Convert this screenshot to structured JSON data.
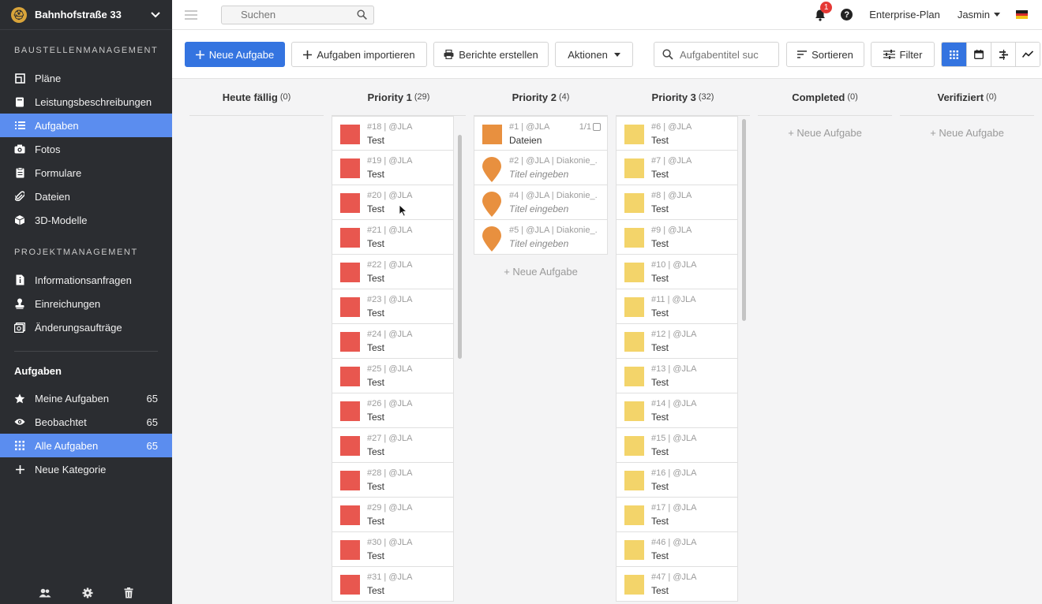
{
  "project": {
    "name": "Bahnhofstraße 33",
    "logo": "helmet-icon"
  },
  "top": {
    "search_placeholder": "Suchen",
    "notifications": "1",
    "help": "?",
    "plan": "Enterprise-Plan",
    "user": "Jasmin"
  },
  "sidebar": {
    "section1": "BAUSTELLENMANAGEMENT",
    "items1": [
      {
        "label": "Pläne",
        "icon": "plans-icon"
      },
      {
        "label": "Leistungsbeschreibungen",
        "icon": "book-icon"
      },
      {
        "label": "Aufgaben",
        "icon": "list-icon"
      },
      {
        "label": "Fotos",
        "icon": "camera-icon"
      },
      {
        "label": "Formulare",
        "icon": "clipboard-icon"
      },
      {
        "label": "Dateien",
        "icon": "paperclip-icon"
      },
      {
        "label": "3D-Modelle",
        "icon": "cube-icon"
      }
    ],
    "section2": "PROJEKTMANAGEMENT",
    "items2": [
      {
        "label": "Informationsanfragen",
        "icon": "info-doc-icon"
      },
      {
        "label": "Einreichungen",
        "icon": "stamp-icon"
      },
      {
        "label": "Änderungsaufträge",
        "icon": "change-order-icon"
      }
    ],
    "tasks_heading": "Aufgaben",
    "task_items": [
      {
        "label": "Meine Aufgaben",
        "count": "65",
        "icon": "star-icon"
      },
      {
        "label": "Beobachtet",
        "count": "65",
        "icon": "eye-icon"
      },
      {
        "label": "Alle Aufgaben",
        "count": "65",
        "icon": "grid-icon"
      },
      {
        "label": "Neue Kategorie",
        "count": "",
        "icon": "plus-icon"
      }
    ]
  },
  "toolbar": {
    "new_task": "Neue Aufgabe",
    "import": "Aufgaben importieren",
    "reports": "Berichte erstellen",
    "actions": "Aktionen",
    "search_placeholder": "Aufgabentitel suc",
    "sort": "Sortieren",
    "filter": "Filter"
  },
  "colors": {
    "accent": "#3474e0",
    "priority1": "#e8574f",
    "priority2": "#e8903f",
    "priority3": "#f3d46a"
  },
  "board": {
    "new_task_label": "+ Neue Aufgabe",
    "columns": [
      {
        "title": "Heute fällig",
        "count": "(0)"
      },
      {
        "title": "Priority 1",
        "count": "(29)"
      },
      {
        "title": "Priority 2",
        "count": "(4)"
      },
      {
        "title": "Priority 3",
        "count": "(32)"
      },
      {
        "title": "Completed",
        "count": "(0)"
      },
      {
        "title": "Verifiziert",
        "count": "(0)"
      }
    ],
    "p1_cards": [
      {
        "meta": "#18 | @JLA",
        "title": "Test"
      },
      {
        "meta": "#19 | @JLA",
        "title": "Test"
      },
      {
        "meta": "#20 | @JLA",
        "title": "Test"
      },
      {
        "meta": "#21 | @JLA",
        "title": "Test"
      },
      {
        "meta": "#22 | @JLA",
        "title": "Test"
      },
      {
        "meta": "#23 | @JLA",
        "title": "Test"
      },
      {
        "meta": "#24 | @JLA",
        "title": "Test"
      },
      {
        "meta": "#25 | @JLA",
        "title": "Test"
      },
      {
        "meta": "#26 | @JLA",
        "title": "Test"
      },
      {
        "meta": "#27 | @JLA",
        "title": "Test"
      },
      {
        "meta": "#28 | @JLA",
        "title": "Test"
      },
      {
        "meta": "#29 | @JLA",
        "title": "Test"
      },
      {
        "meta": "#30 | @JLA",
        "title": "Test"
      },
      {
        "meta": "#31 | @JLA",
        "title": "Test"
      }
    ],
    "p2_cards": [
      {
        "meta": "#1 | @JLA",
        "title": "Dateien",
        "check": "1/1",
        "shape": "square"
      },
      {
        "meta": "#2 | @JLA | Diakonie_...",
        "title": "Titel eingeben",
        "check": "",
        "shape": "pin"
      },
      {
        "meta": "#4 | @JLA | Diakonie_...",
        "title": "Titel eingeben",
        "check": "",
        "shape": "pin"
      },
      {
        "meta": "#5 | @JLA | Diakonie_...",
        "title": "Titel eingeben",
        "check": "",
        "shape": "pin"
      }
    ],
    "p3_cards": [
      {
        "meta": "#6 | @JLA",
        "title": "Test"
      },
      {
        "meta": "#7 | @JLA",
        "title": "Test"
      },
      {
        "meta": "#8 | @JLA",
        "title": "Test"
      },
      {
        "meta": "#9 | @JLA",
        "title": "Test"
      },
      {
        "meta": "#10 | @JLA",
        "title": "Test"
      },
      {
        "meta": "#11 | @JLA",
        "title": "Test"
      },
      {
        "meta": "#12 | @JLA",
        "title": "Test"
      },
      {
        "meta": "#13 | @JLA",
        "title": "Test"
      },
      {
        "meta": "#14 | @JLA",
        "title": "Test"
      },
      {
        "meta": "#15 | @JLA",
        "title": "Test"
      },
      {
        "meta": "#16 | @JLA",
        "title": "Test"
      },
      {
        "meta": "#17 | @JLA",
        "title": "Test"
      },
      {
        "meta": "#46 | @JLA",
        "title": "Test"
      },
      {
        "meta": "#47 | @JLA",
        "title": "Test"
      }
    ]
  }
}
